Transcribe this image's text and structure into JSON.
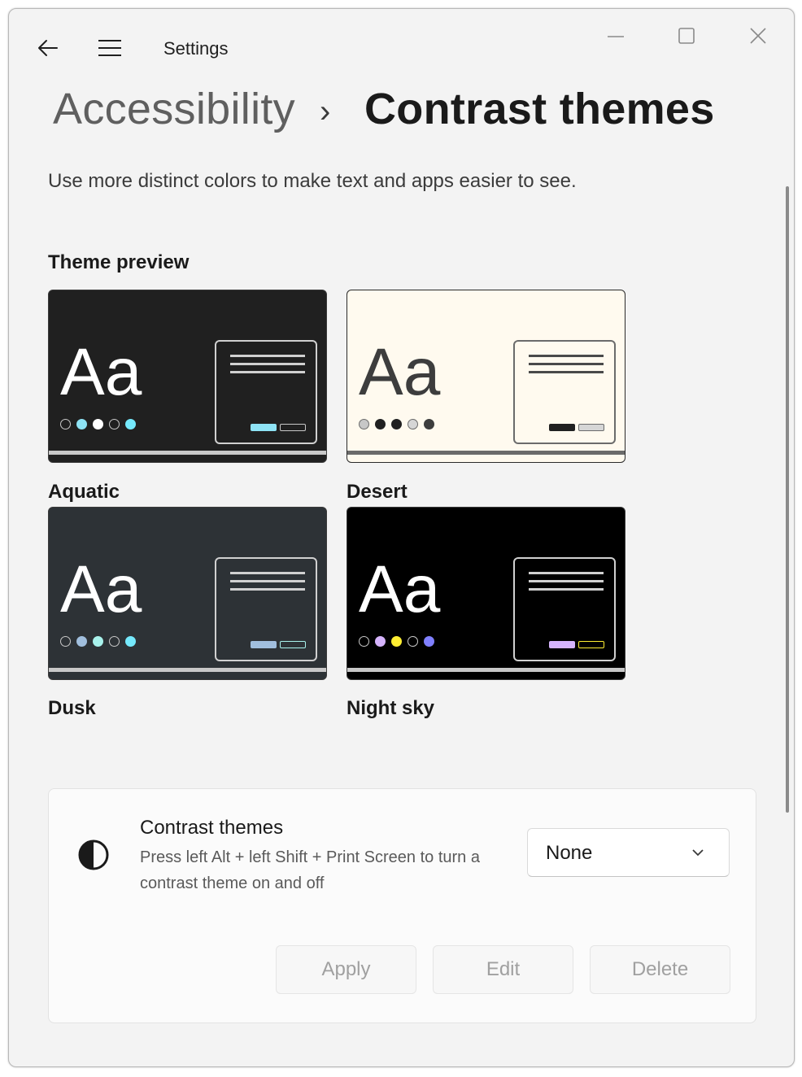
{
  "window": {
    "title": "Settings"
  },
  "breadcrumb": {
    "parent": "Accessibility",
    "separator": "›",
    "current": "Contrast themes"
  },
  "description": "Use more distinct colors to make text and apps easier to see.",
  "preview": {
    "label": "Theme preview",
    "themes": [
      {
        "name": "Aquatic",
        "sample": "Aa",
        "bg": "#202020",
        "fg": "#ffffff",
        "bar": "#c8c8c8",
        "dots": [
          "#202020",
          "#8ee3f5",
          "#ffffff",
          "#202020",
          "#75e9fc"
        ],
        "btn1": "#8ee3f5",
        "btn2": "#202020",
        "btn2_border": "#c8c8c8",
        "win_border": "#d0d0d0",
        "lines": "#d0d0d0"
      },
      {
        "name": "Desert",
        "sample": "Aa",
        "bg": "#fffaef",
        "fg": "#3d3d3d",
        "bar": "#6b6b6b",
        "dots": [
          "#c7c7c7",
          "#202020",
          "#202020",
          "#d6d6d6",
          "#3d3d3d"
        ],
        "btn1": "#202020",
        "btn2": "#d6d6d6",
        "btn2_border": "#6b6b6b",
        "win_border": "#6b6b6b",
        "lines": "#4a4a4a"
      },
      {
        "name": "Dusk",
        "sample": "Aa",
        "bg": "#2d3236",
        "fg": "#ffffff",
        "bar": "#c8c8c8",
        "dots": [
          "#2d3236",
          "#a1bfde",
          "#a8f2ec",
          "#2d3236",
          "#75e9fc"
        ],
        "btn1": "#a1bfde",
        "btn2": "#2d3236",
        "btn2_border": "#a8f2ec",
        "win_border": "#d0d0d0",
        "lines": "#d0d0d0"
      },
      {
        "name": "Night sky",
        "sample": "Aa",
        "bg": "#000000",
        "fg": "#ffffff",
        "bar": "#c8c8c8",
        "dots": [
          "#000000",
          "#d6b4fd",
          "#ffee32",
          "#000000",
          "#8080ff"
        ],
        "btn1": "#d6b4fd",
        "btn2": "#000000",
        "btn2_border": "#ffee32",
        "win_border": "#d0d0d0",
        "lines": "#d0d0d0"
      }
    ]
  },
  "setting": {
    "title": "Contrast themes",
    "subtitle": "Press left Alt + left Shift + Print Screen to turn a contrast theme on and off",
    "icon": "contrast-half-circle-icon",
    "select_value": "None",
    "buttons": {
      "apply": "Apply",
      "edit": "Edit",
      "delete": "Delete"
    }
  }
}
